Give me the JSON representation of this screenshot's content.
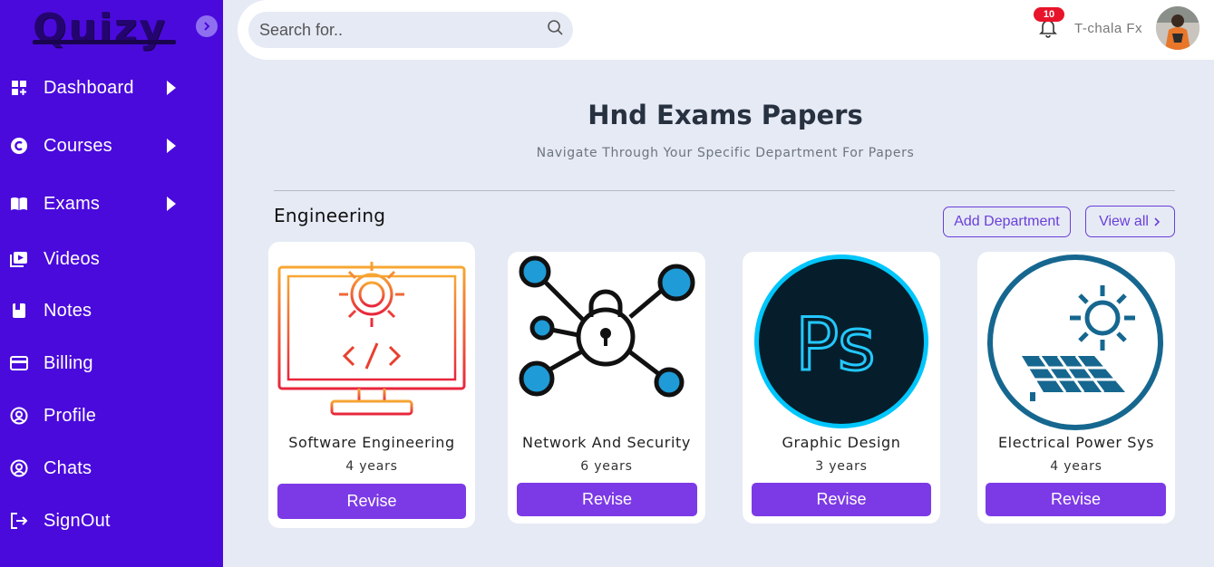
{
  "sidebar": {
    "logo": "Quizy",
    "items": [
      {
        "label": "Dashboard",
        "icon": "dashboard-icon"
      },
      {
        "label": "Courses",
        "icon": "courses-icon"
      },
      {
        "label": "Exams",
        "icon": "book-icon"
      },
      {
        "label": "Videos",
        "icon": "video-icon"
      },
      {
        "label": "Notes",
        "icon": "notes-icon"
      },
      {
        "label": "Billing",
        "icon": "credit-card-icon"
      },
      {
        "label": "Profile",
        "icon": "user-circle-icon"
      },
      {
        "label": "Chats",
        "icon": "user-circle-icon"
      },
      {
        "label": "SignOut",
        "icon": "sign-out-icon"
      }
    ]
  },
  "search": {
    "placeholder": "Search for.."
  },
  "header": {
    "notification_count": "10",
    "username": "T-chala Fx"
  },
  "main": {
    "title": "Hnd Exams Papers",
    "subtitle": "Navigate Through Your Specific Department For Papers",
    "section_title": "Engineering",
    "add_department_label": "Add Department",
    "view_all_label": "View all"
  },
  "cards": [
    {
      "name": "Software Engineering",
      "years": "4 years",
      "action": "Revise",
      "icon": "monitor-gear-code-icon"
    },
    {
      "name": "Network And Security",
      "years": "6 years",
      "action": "Revise",
      "icon": "network-lock-icon"
    },
    {
      "name": "Graphic Design",
      "years": "3 years",
      "action": "Revise",
      "icon": "photoshop-icon"
    },
    {
      "name": "Electrical Power Sys",
      "years": "4 years",
      "action": "Revise",
      "icon": "solar-panel-icon"
    }
  ],
  "colors": {
    "sidebar": "#4a0adc",
    "accent": "#7c3ae6",
    "background": "#e6eaf5",
    "badge": "#e8142a"
  }
}
